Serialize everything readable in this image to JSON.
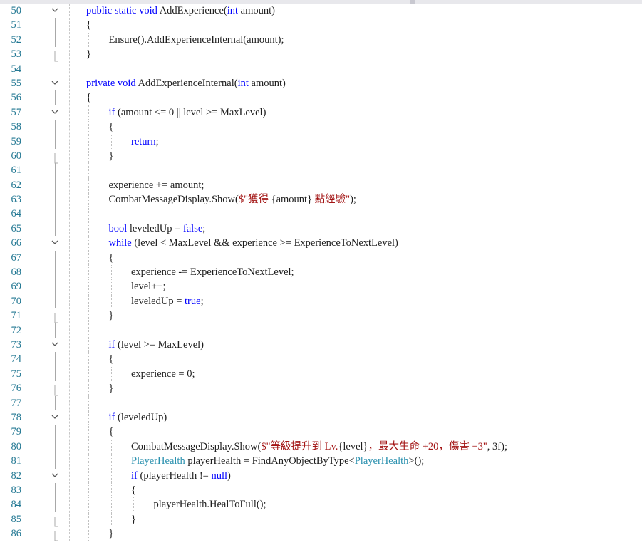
{
  "editor": {
    "language": "C#",
    "colors": {
      "keyword": "#0000ff",
      "type": "#2b91af",
      "string": "#a31515",
      "number": "#098658",
      "text": "#1e1e1e",
      "line_number": "#237893"
    },
    "lines": [
      {
        "num": "50",
        "indent": 0,
        "fold": "expanded",
        "tokens": [
          {
            "t": "public",
            "c": "kw"
          },
          {
            "t": " "
          },
          {
            "t": "static",
            "c": "kw"
          },
          {
            "t": " "
          },
          {
            "t": "void",
            "c": "kw"
          },
          {
            "t": " AddExperience("
          },
          {
            "t": "int",
            "c": "kw"
          },
          {
            "t": " amount)"
          }
        ]
      },
      {
        "num": "51",
        "indent": 0,
        "tokens": [
          {
            "t": "{"
          }
        ]
      },
      {
        "num": "52",
        "indent": 1,
        "tokens": [
          {
            "t": "Ensure().AddExperienceInternal(amount);"
          }
        ]
      },
      {
        "num": "53",
        "indent": 0,
        "fold": "end",
        "tokens": [
          {
            "t": "}"
          }
        ]
      },
      {
        "num": "54",
        "indent": 0,
        "tokens": []
      },
      {
        "num": "55",
        "indent": 0,
        "fold": "expanded",
        "tokens": [
          {
            "t": "private",
            "c": "kw"
          },
          {
            "t": " "
          },
          {
            "t": "void",
            "c": "kw"
          },
          {
            "t": " AddExperienceInternal("
          },
          {
            "t": "int",
            "c": "kw"
          },
          {
            "t": " amount)"
          }
        ]
      },
      {
        "num": "56",
        "indent": 0,
        "tokens": [
          {
            "t": "{"
          }
        ]
      },
      {
        "num": "57",
        "indent": 1,
        "fold": "expanded",
        "tokens": [
          {
            "t": "if",
            "c": "kw"
          },
          {
            "t": " (amount <= 0 || level >= MaxLevel)"
          }
        ]
      },
      {
        "num": "58",
        "indent": 1,
        "tokens": [
          {
            "t": "{"
          }
        ]
      },
      {
        "num": "59",
        "indent": 2,
        "tokens": [
          {
            "t": "return",
            "c": "kw"
          },
          {
            "t": ";"
          }
        ]
      },
      {
        "num": "60",
        "indent": 1,
        "fold": "end",
        "tokens": [
          {
            "t": "}"
          }
        ]
      },
      {
        "num": "61",
        "indent": 1,
        "tokens": []
      },
      {
        "num": "62",
        "indent": 1,
        "tokens": [
          {
            "t": "experience += amount;"
          }
        ]
      },
      {
        "num": "63",
        "indent": 1,
        "tokens": [
          {
            "t": "CombatMessageDisplay.Show("
          },
          {
            "t": "$\"獲得 ",
            "c": "st"
          },
          {
            "t": "{amount}"
          },
          {
            "t": " 點經驗\"",
            "c": "st"
          },
          {
            "t": ");"
          }
        ]
      },
      {
        "num": "64",
        "indent": 1,
        "tokens": []
      },
      {
        "num": "65",
        "indent": 1,
        "tokens": [
          {
            "t": "bool",
            "c": "kw"
          },
          {
            "t": " leveledUp = "
          },
          {
            "t": "false",
            "c": "kw"
          },
          {
            "t": ";"
          }
        ]
      },
      {
        "num": "66",
        "indent": 1,
        "fold": "expanded",
        "tokens": [
          {
            "t": "while",
            "c": "kw"
          },
          {
            "t": " (level < MaxLevel && experience >= ExperienceToNextLevel)"
          }
        ]
      },
      {
        "num": "67",
        "indent": 1,
        "tokens": [
          {
            "t": "{"
          }
        ]
      },
      {
        "num": "68",
        "indent": 2,
        "tokens": [
          {
            "t": "experience -= ExperienceToNextLevel;"
          }
        ]
      },
      {
        "num": "69",
        "indent": 2,
        "tokens": [
          {
            "t": "level++;"
          }
        ]
      },
      {
        "num": "70",
        "indent": 2,
        "tokens": [
          {
            "t": "leveledUp = "
          },
          {
            "t": "true",
            "c": "kw"
          },
          {
            "t": ";"
          }
        ]
      },
      {
        "num": "71",
        "indent": 1,
        "fold": "end",
        "tokens": [
          {
            "t": "}"
          }
        ]
      },
      {
        "num": "72",
        "indent": 1,
        "tokens": []
      },
      {
        "num": "73",
        "indent": 1,
        "fold": "expanded",
        "tokens": [
          {
            "t": "if",
            "c": "kw"
          },
          {
            "t": " (level >= MaxLevel)"
          }
        ]
      },
      {
        "num": "74",
        "indent": 1,
        "tokens": [
          {
            "t": "{"
          }
        ]
      },
      {
        "num": "75",
        "indent": 2,
        "tokens": [
          {
            "t": "experience = 0;"
          }
        ]
      },
      {
        "num": "76",
        "indent": 1,
        "fold": "end",
        "tokens": [
          {
            "t": "}"
          }
        ]
      },
      {
        "num": "77",
        "indent": 1,
        "tokens": []
      },
      {
        "num": "78",
        "indent": 1,
        "fold": "expanded",
        "tokens": [
          {
            "t": "if",
            "c": "kw"
          },
          {
            "t": " (leveledUp)"
          }
        ]
      },
      {
        "num": "79",
        "indent": 1,
        "tokens": [
          {
            "t": "{"
          }
        ]
      },
      {
        "num": "80",
        "indent": 2,
        "tokens": [
          {
            "t": "CombatMessageDisplay.Show("
          },
          {
            "t": "$\"等級提升到 Lv.",
            "c": "st"
          },
          {
            "t": "{level}"
          },
          {
            "t": "，最大生命 +20，傷害 +3\"",
            "c": "st"
          },
          {
            "t": ", 3f);"
          }
        ]
      },
      {
        "num": "81",
        "indent": 2,
        "tokens": [
          {
            "t": "PlayerHealth",
            "c": "tp"
          },
          {
            "t": " playerHealth = FindAnyObjectByType<"
          },
          {
            "t": "PlayerHealth",
            "c": "tp"
          },
          {
            "t": ">();"
          }
        ]
      },
      {
        "num": "82",
        "indent": 2,
        "fold": "expanded",
        "tokens": [
          {
            "t": "if",
            "c": "kw"
          },
          {
            "t": " (playerHealth != "
          },
          {
            "t": "null",
            "c": "kw"
          },
          {
            "t": ")"
          }
        ]
      },
      {
        "num": "83",
        "indent": 2,
        "tokens": [
          {
            "t": "{"
          }
        ]
      },
      {
        "num": "84",
        "indent": 3,
        "tokens": [
          {
            "t": "playerHealth.HealToFull();"
          }
        ]
      },
      {
        "num": "85",
        "indent": 2,
        "fold": "end",
        "tokens": [
          {
            "t": "}"
          }
        ]
      },
      {
        "num": "86",
        "indent": 1,
        "fold": "end",
        "tokens": [
          {
            "t": "}"
          }
        ]
      }
    ]
  }
}
